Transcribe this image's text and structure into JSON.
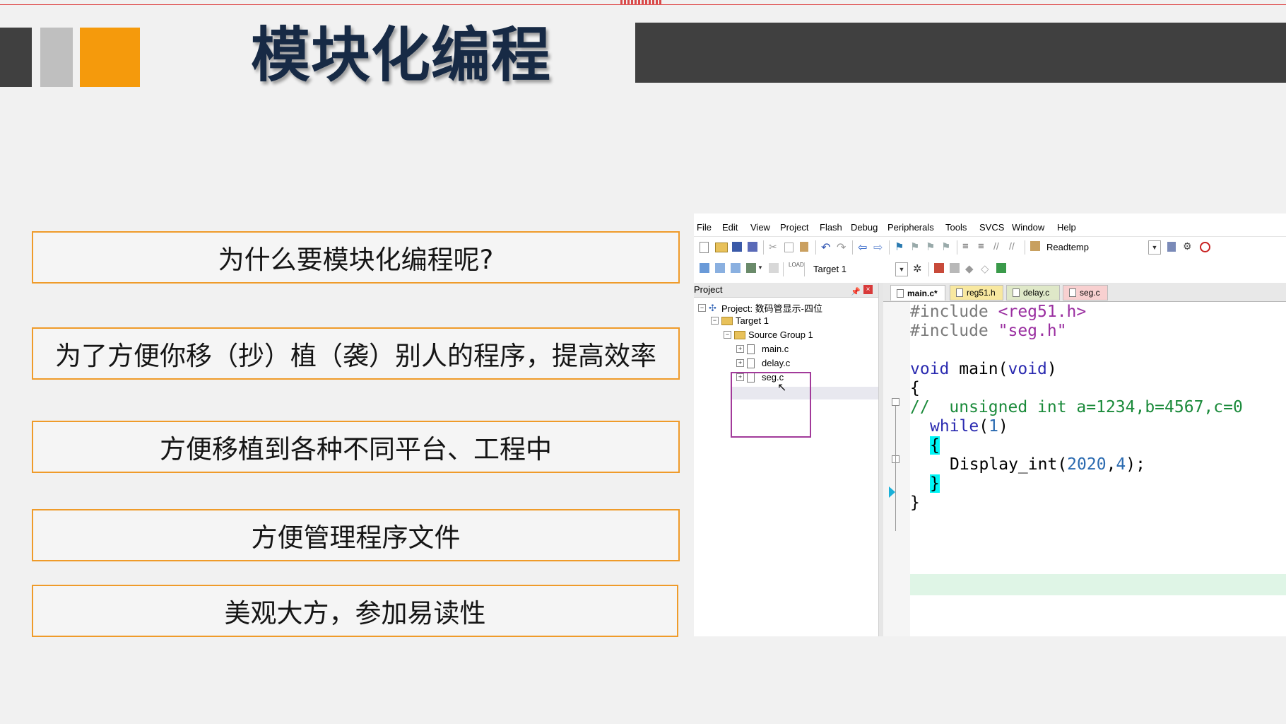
{
  "slide": {
    "title": "模块化编程",
    "points": [
      "为什么要模块化编程呢?",
      "为了方便你移（抄）植（袭）别人的程序，提高效率",
      "方便移植到各种不同平台、工程中",
      "方便管理程序文件",
      "美观大方，参加易读性"
    ],
    "colors": {
      "accent_orange": "#f59a0c",
      "dark_gray": "#404040",
      "light_gray": "#bfbfbf",
      "title": "#172a45"
    }
  },
  "ide": {
    "menu": [
      "File",
      "Edit",
      "View",
      "Project",
      "Flash",
      "Debug",
      "Peripherals",
      "Tools",
      "SVCS",
      "Window",
      "Help"
    ],
    "toolbar1": {
      "find_combo_value": "Readtemp"
    },
    "toolbar2": {
      "target_combo_value": "Target 1"
    },
    "project_panel": {
      "title": "Project",
      "project_name": "Project: 数码管显示-四位",
      "target": "Target 1",
      "group": "Source Group 1",
      "files": [
        "main.c",
        "delay.c",
        "seg.c"
      ]
    },
    "tabs": [
      "main.c*",
      "reg51.h",
      "delay.c",
      "seg.c"
    ],
    "code": {
      "l1_kw": "#include",
      "l1_arg": " <reg51.h>",
      "l2_kw": "#include",
      "l2_arg": " \"seg.h\"",
      "l4_type": "void",
      "l4_name": " main(",
      "l4_arg": "void",
      "l4_end": ")",
      "l5": "{",
      "l6": "//  unsigned int a=1234,b=4567,c=0",
      "l7_kw": "while",
      "l7_open": "(",
      "l7_num": "1",
      "l7_close": ")",
      "l8": "{",
      "l9_call": "Display_int(",
      "l9_n1": "2020",
      "l9_comma": ",",
      "l9_n2": "4",
      "l9_end": ");",
      "l10": "}",
      "l11": "}"
    }
  }
}
